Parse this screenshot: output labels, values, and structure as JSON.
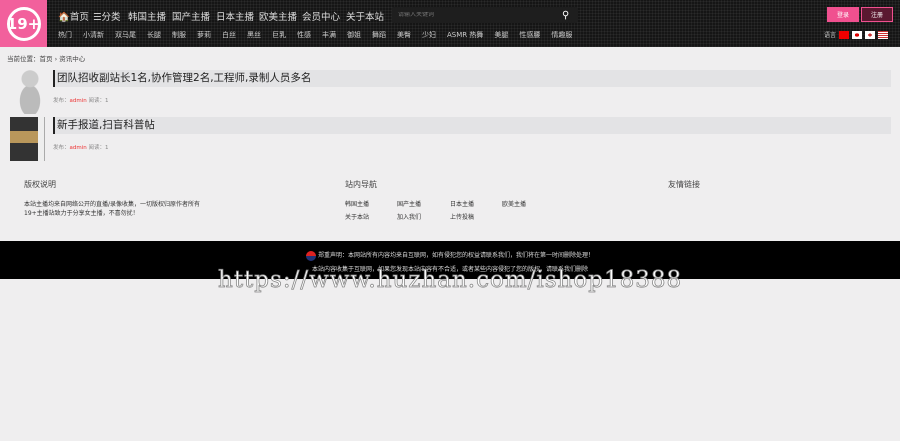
{
  "header": {
    "logo": "19+",
    "nav": [
      "🏠首页",
      "☰分类",
      "韩国主播",
      "国产主播",
      "日本主播",
      "欧美主播",
      "会员中心",
      "关于本站"
    ],
    "search_placeholder": "请输入关键词",
    "subnav": [
      "热门",
      "小清新",
      "双马尾",
      "长腿",
      "制服",
      "萝莉",
      "白丝",
      "黑丝",
      "巨乳",
      "性感",
      "丰满",
      "御姐",
      "舞蹈",
      "美臀",
      "少妇",
      "ASMR 热舞",
      "美腿",
      "性感腰",
      "情趣服"
    ],
    "login": "登录",
    "register": "注册",
    "lang_label": "语言"
  },
  "breadcrumb": "当前位置：首页 › 资讯中心",
  "posts": [
    {
      "title": "团队招收副站长1名,协作管理2名,工程师,录制人员多名",
      "author_label": "发布：",
      "author": "admin",
      "views": "阅读：1"
    },
    {
      "title": "新手报道,扫盲科普帖",
      "author_label": "发布：",
      "author": "admin",
      "views": "阅读：1"
    }
  ],
  "footer": {
    "copyright_title": "版权说明",
    "copyright_lines": [
      "本站主播均来自网络公开的直播/录像收集，一切版权归原作者所有",
      "19+主播站致力于分享女主播，不喜勿扰！"
    ],
    "nav_title": "站内导航",
    "nav_links": [
      "韩国主播",
      "国产主播",
      "日本主播",
      "欧美主播",
      "关于本站",
      "加入我们",
      "上传投稿"
    ],
    "links_title": "友情链接",
    "notice1": "郑重声明：本网站所有内容均来自互联网，如有侵犯您的权益请联系我们，我们将在第一时间删除处理！",
    "notice2": "本站内容收集于互联网，如果您发现本站内容有不合适，或者某些内容侵犯了您的版权，请联系我们删除"
  },
  "watermark": "https://www.huzhan.com/ishop18388"
}
